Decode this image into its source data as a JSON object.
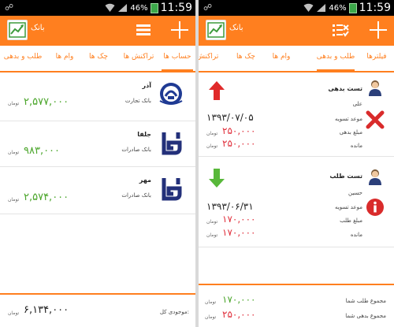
{
  "status": {
    "time": "11:59",
    "battery": "46%"
  },
  "app": {
    "title": "بانک"
  },
  "left": {
    "tabs": [
      "حساب ها",
      "تراکنش ها",
      "چک ها",
      "وام ها",
      "طلب و بدهی"
    ],
    "accounts": [
      {
        "name": "آذر",
        "bank": "بانک تجارت",
        "amount": "۲,۵۷۷,۰۰۰",
        "unit": "تومان",
        "logo": "tejarat-logo"
      },
      {
        "name": "جلفا",
        "bank": "بانک صادرات",
        "amount": "۹۸۳,۰۰۰",
        "unit": "تومان",
        "logo": "saderat-logo"
      },
      {
        "name": "مهر",
        "bank": "بانک صادرات",
        "amount": "۲,۵۷۴,۰۰۰",
        "unit": "تومان",
        "logo": "saderat-logo"
      }
    ],
    "footer": {
      "label": "موجودی کل:",
      "amount": "۶,۱۳۴,۰۰۰",
      "unit": "تومان"
    }
  },
  "right": {
    "tabs": [
      "فیلترها",
      "طلب و بدهی",
      "وام ها",
      "چک ها",
      "تراکنش ها"
    ],
    "items": [
      {
        "title": "تست بدهی",
        "person": "علی",
        "due_label": "موعد تسویه",
        "due_date": "۱۳۹۳/۰۷/۰۵",
        "amount_label": "مبلغ بدهی",
        "amount": "۲۵۰,۰۰۰",
        "amount_unit": "تومان",
        "remain_label": "مانده",
        "remain": "۲۵۰,۰۰۰",
        "remain_unit": "تومان",
        "direction_icon": "arrow-up-icon",
        "status_icon": "x-mark-icon",
        "amount_color": "#e0303c"
      },
      {
        "title": "تست طلب",
        "person": "حسین",
        "due_label": "موعد تسویه",
        "due_date": "۱۳۹۳/۰۶/۳۱",
        "amount_label": "مبلغ طلب",
        "amount": "۱۷۰,۰۰۰",
        "amount_unit": "تومان",
        "remain_label": "مانده",
        "remain": "۱۷۰,۰۰۰",
        "remain_unit": "تومان",
        "direction_icon": "arrow-down-icon",
        "status_icon": "info-icon",
        "amount_color": "#e0303c"
      }
    ],
    "footer": {
      "receivable_label": "مجموع طلب شما",
      "receivable": "۱۷۰,۰۰۰",
      "receivable_unit": "تومان",
      "debt_label": "مجموع بدهی شما",
      "debt": "۲۵۰,۰۰۰",
      "debt_unit": "تومان"
    }
  },
  "colors": {
    "accent": "#ff7f1f",
    "green": "#4aa52a",
    "red": "#e0303c"
  }
}
